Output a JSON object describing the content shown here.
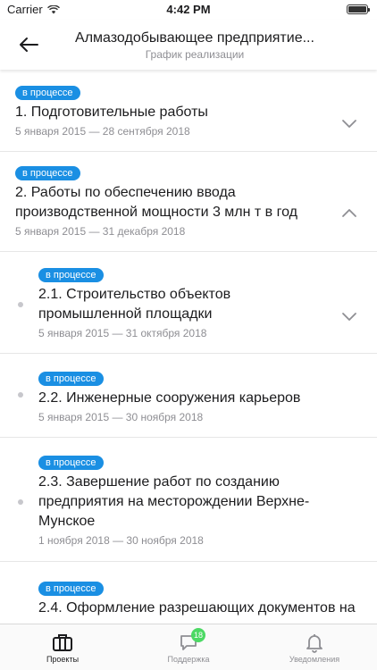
{
  "status": {
    "carrier": "Carrier",
    "time": "4:42 PM"
  },
  "header": {
    "title": "Алмазодобывающее предприятие...",
    "subtitle": "График реализации"
  },
  "items": [
    {
      "status": "в процессе",
      "title": "1. Подготовительные работы",
      "dates": "5 января 2015 — 28 сентября 2018"
    },
    {
      "status": "в процессе",
      "title": "2. Работы по обеспечению ввода производственной мощности 3 млн т в год",
      "dates": "5 января 2015 — 31 декабря 2018"
    },
    {
      "status": "в процессе",
      "title": "2.1. Строительство объектов промышленной площадки",
      "dates": "5 января 2015 — 31 октября 2018"
    },
    {
      "status": "в процессе",
      "title": "2.2. Инженерные сооружения карьеров",
      "dates": "5 января 2015 — 30 ноября 2018"
    },
    {
      "status": "в процессе",
      "title": "2.3. Завершение работ по созданию предприятия на месторождении Верхне-Мунское",
      "dates": "1 ноября 2018 — 30 ноября 2018"
    },
    {
      "status": "в процессе",
      "title": "2.4. Оформление разрешающих документов на",
      "dates": ""
    }
  ],
  "tabs": [
    {
      "label": "Проекты",
      "icon": "briefcase-icon"
    },
    {
      "label": "Поддержка",
      "icon": "chat-icon",
      "badge": "18"
    },
    {
      "label": "Уведомления",
      "icon": "bell-icon"
    }
  ],
  "colors": {
    "accent": "#1a8fe3",
    "badge": "#4cd964",
    "text": "#1c1c1e",
    "muted": "#8e8e93"
  }
}
